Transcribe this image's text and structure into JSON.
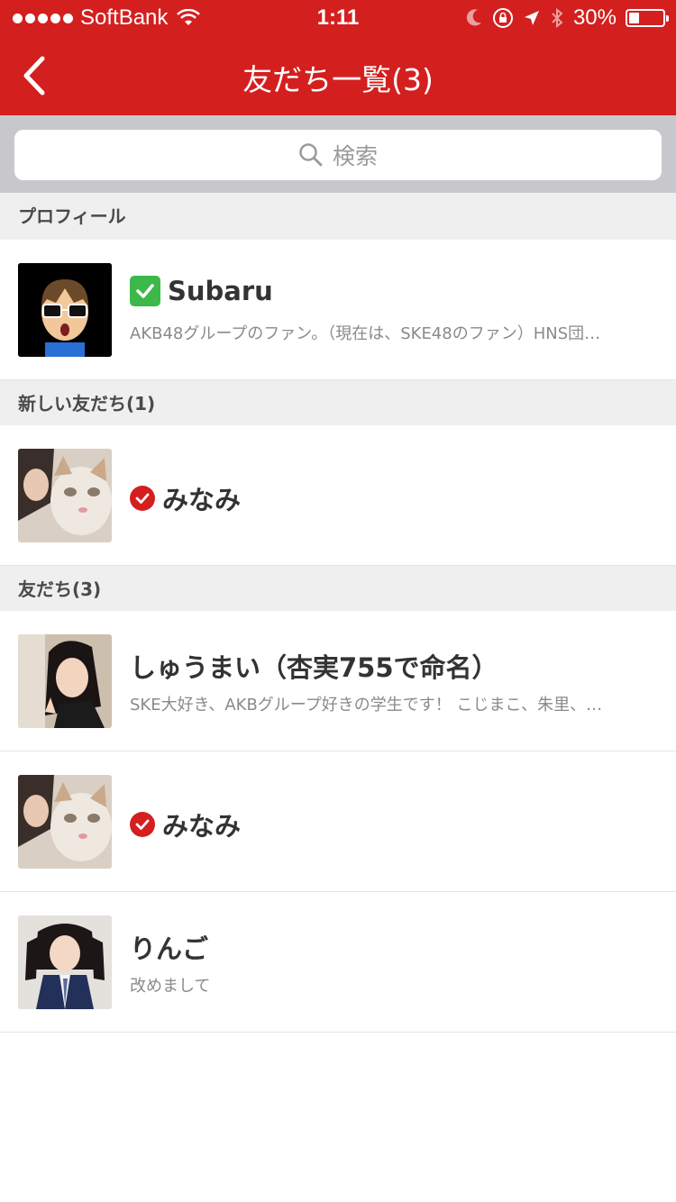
{
  "status_bar": {
    "carrier": "SoftBank",
    "time": "1:11",
    "battery_percent": "30%",
    "battery_level": 0.3
  },
  "nav": {
    "title": "友だち一覧(3)",
    "back_icon": "chevron-left-icon"
  },
  "search": {
    "placeholder": "検索",
    "icon": "search-icon"
  },
  "sections": {
    "profile": {
      "header": "プロフィール",
      "item": {
        "name": "✅Subaru",
        "name_text": "Subaru",
        "desc": "AKB48グループのファン。（現在は、SKE48のファン）HNS団…"
      }
    },
    "new_friends": {
      "header": "新しい友だち(1)",
      "items": [
        {
          "name": "みなみ",
          "verified": true
        }
      ]
    },
    "friends": {
      "header": "友だち(3)",
      "items": [
        {
          "name": "しゅうまい（杏実755で命名）",
          "desc": "SKE大好き、AKBグループ好きの学生です！ こじまこ、朱里、…",
          "verified": false
        },
        {
          "name": "みなみ",
          "desc": "",
          "verified": true
        },
        {
          "name": "りんご",
          "desc": "改めまして",
          "verified": false
        }
      ]
    }
  },
  "colors": {
    "brand_red": "#d41f1f",
    "section_bg": "#efefef",
    "search_bg": "#c8c8cc"
  }
}
